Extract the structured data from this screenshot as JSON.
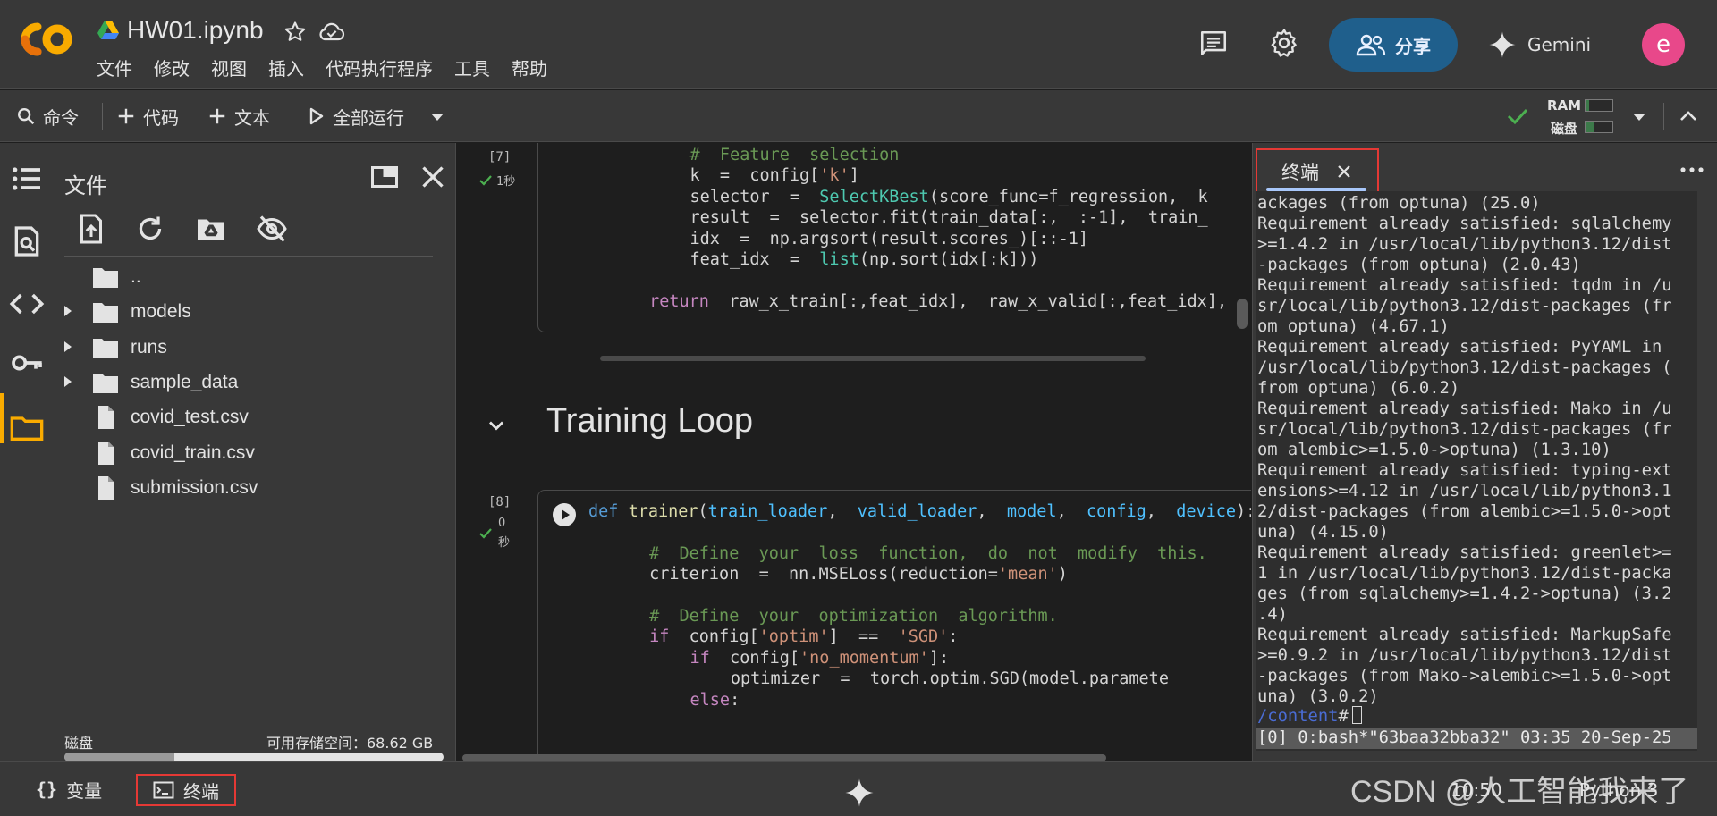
{
  "header": {
    "notebook_title": "HW01.ipynb",
    "menu": [
      "文件",
      "修改",
      "视图",
      "插入",
      "代码执行程序",
      "工具",
      "帮助"
    ],
    "share_label": "分享",
    "gemini_label": "Gemini",
    "avatar_initial": "e"
  },
  "toolbar": {
    "command_label": "命令",
    "code_label": "代码",
    "text_label": "文本",
    "run_all_label": "全部运行",
    "ram_label": "RAM",
    "disk_label": "磁盘"
  },
  "file_panel": {
    "title": "文件",
    "items": [
      {
        "name": "..",
        "type": "parent"
      },
      {
        "name": "models",
        "type": "folder"
      },
      {
        "name": "runs",
        "type": "folder"
      },
      {
        "name": "sample_data",
        "type": "folder"
      },
      {
        "name": "covid_test.csv",
        "type": "file"
      },
      {
        "name": "covid_train.csv",
        "type": "file"
      },
      {
        "name": "submission.csv",
        "type": "file"
      }
    ],
    "disk_label": "磁盘",
    "disk_free": "可用存储空间：68.62 GB",
    "disk_used_fraction": 0.29
  },
  "notebook": {
    "cell7": {
      "exec_count": "[7]",
      "exec_time": "1秒",
      "lines": [
        {
          "indent": 5,
          "parts": [
            [
              "cm",
              "#  Feature  selection"
            ]
          ]
        },
        {
          "indent": 5,
          "parts": [
            [
              "",
              "k  =  config["
            ],
            [
              "str",
              "'k'"
            ],
            [
              "",
              "]"
            ]
          ]
        },
        {
          "indent": 5,
          "parts": [
            [
              "",
              "selector  =  "
            ],
            [
              "cls",
              "SelectKBest"
            ],
            [
              "",
              "(score_func=f_regression,  k"
            ]
          ]
        },
        {
          "indent": 5,
          "parts": [
            [
              "",
              "result  =  selector.fit(train_data[:,  :-1],  train_"
            ]
          ]
        },
        {
          "indent": 5,
          "parts": [
            [
              "",
              "idx  =  np.argsort(result.scores_)[::-1]"
            ]
          ]
        },
        {
          "indent": 5,
          "parts": [
            [
              "",
              "feat_idx  =  "
            ],
            [
              "cls",
              "list"
            ],
            [
              "",
              "(np.sort(idx[:k]))"
            ]
          ]
        },
        {
          "indent": 0,
          "parts": [
            [
              "",
              ""
            ]
          ]
        },
        {
          "indent": 3,
          "parts": [
            [
              "kw",
              "return"
            ],
            [
              "",
              "  raw_x_train[:,feat_idx],  raw_x_valid[:,feat_idx],"
            ]
          ]
        }
      ]
    },
    "md_heading": "Training Loop",
    "cell8": {
      "exec_count": "[8]",
      "exec_time_value": "0",
      "exec_time_unit": "秒",
      "lines": [
        {
          "indent": 0,
          "parts": [
            [
              "kwb",
              "def"
            ],
            [
              "",
              " "
            ],
            [
              "fn",
              "trainer"
            ],
            [
              "",
              "("
            ],
            [
              "par",
              "train_loader"
            ],
            [
              "",
              ",  "
            ],
            [
              "par",
              "valid_loader"
            ],
            [
              "",
              ",  "
            ],
            [
              "par",
              "model"
            ],
            [
              "",
              ",  "
            ],
            [
              "par",
              "config"
            ],
            [
              "",
              ",  "
            ],
            [
              "par",
              "device"
            ],
            [
              "",
              "):"
            ]
          ]
        },
        {
          "indent": 0,
          "parts": [
            [
              "",
              ""
            ]
          ]
        },
        {
          "indent": 3,
          "parts": [
            [
              "cm",
              "#  Define  your  loss  function,  do  not  modify  this."
            ]
          ]
        },
        {
          "indent": 3,
          "parts": [
            [
              "",
              "criterion  =  nn.MSELoss(reduction="
            ],
            [
              "str",
              "'mean'"
            ],
            [
              "",
              ")"
            ]
          ]
        },
        {
          "indent": 0,
          "parts": [
            [
              "",
              ""
            ]
          ]
        },
        {
          "indent": 3,
          "parts": [
            [
              "cm",
              "#  Define  your  optimization  algorithm."
            ]
          ]
        },
        {
          "indent": 3,
          "parts": [
            [
              "kw",
              "if"
            ],
            [
              "",
              "  config["
            ],
            [
              "str",
              "'optim'"
            ],
            [
              "",
              "]  ==  "
            ],
            [
              "str",
              "'SGD'"
            ],
            [
              "",
              ":"
            ]
          ]
        },
        {
          "indent": 5,
          "parts": [
            [
              "kw",
              "if"
            ],
            [
              "",
              "  config["
            ],
            [
              "str",
              "'no_momentum'"
            ],
            [
              "",
              "]:"
            ]
          ]
        },
        {
          "indent": 7,
          "parts": [
            [
              "",
              "optimizer  =  torch.optim.SGD(model.paramete"
            ]
          ]
        },
        {
          "indent": 5,
          "parts": [
            [
              "kw",
              "else"
            ],
            [
              "",
              ":"
            ]
          ]
        }
      ]
    }
  },
  "terminal": {
    "tab_label": "终端",
    "lines": [
      "ackages (from optuna) (25.0)",
      "Requirement already satisfied: sqlalchemy",
      ">=1.4.2 in /usr/local/lib/python3.12/dist",
      "-packages (from optuna) (2.0.43)",
      "Requirement already satisfied: tqdm in /u",
      "sr/local/lib/python3.12/dist-packages (fr",
      "om optuna) (4.67.1)",
      "Requirement already satisfied: PyYAML in",
      "/usr/local/lib/python3.12/dist-packages (",
      "from optuna) (6.0.2)",
      "Requirement already satisfied: Mako in /u",
      "sr/local/lib/python3.12/dist-packages (fr",
      "om alembic>=1.5.0->optuna) (1.3.10)",
      "Requirement already satisfied: typing-ext",
      "ensions>=4.12 in /usr/local/lib/python3.1",
      "2/dist-packages (from alembic>=1.5.0->opt",
      "una) (4.15.0)",
      "Requirement already satisfied: greenlet>=",
      "1 in /usr/local/lib/python3.12/dist-packa",
      "ges (from sqlalchemy>=1.4.2->optuna) (3.2",
      ".4)",
      "Requirement already satisfied: MarkupSafe",
      ">=0.9.2 in /usr/local/lib/python3.12/dist",
      "-packages (from Mako->alembic>=1.5.0->opt",
      "una) (3.0.2)"
    ],
    "prompt_path": "/content",
    "prompt_symbol": "#",
    "status_line": "[0] 0:bash*\"63baa32bba32\" 03:35 20-Sep-25"
  },
  "statusbar": {
    "variables_label": "变量",
    "terminal_label": "终端",
    "time": "10:50",
    "runtime": "Python 3"
  },
  "watermark": "CSDN @人工智能我来了",
  "colors": {
    "accent_share": "#1f5f8c",
    "highlight_red": "#e53935",
    "success_green": "#4caf50",
    "avatar_pink": "#e8488a"
  }
}
